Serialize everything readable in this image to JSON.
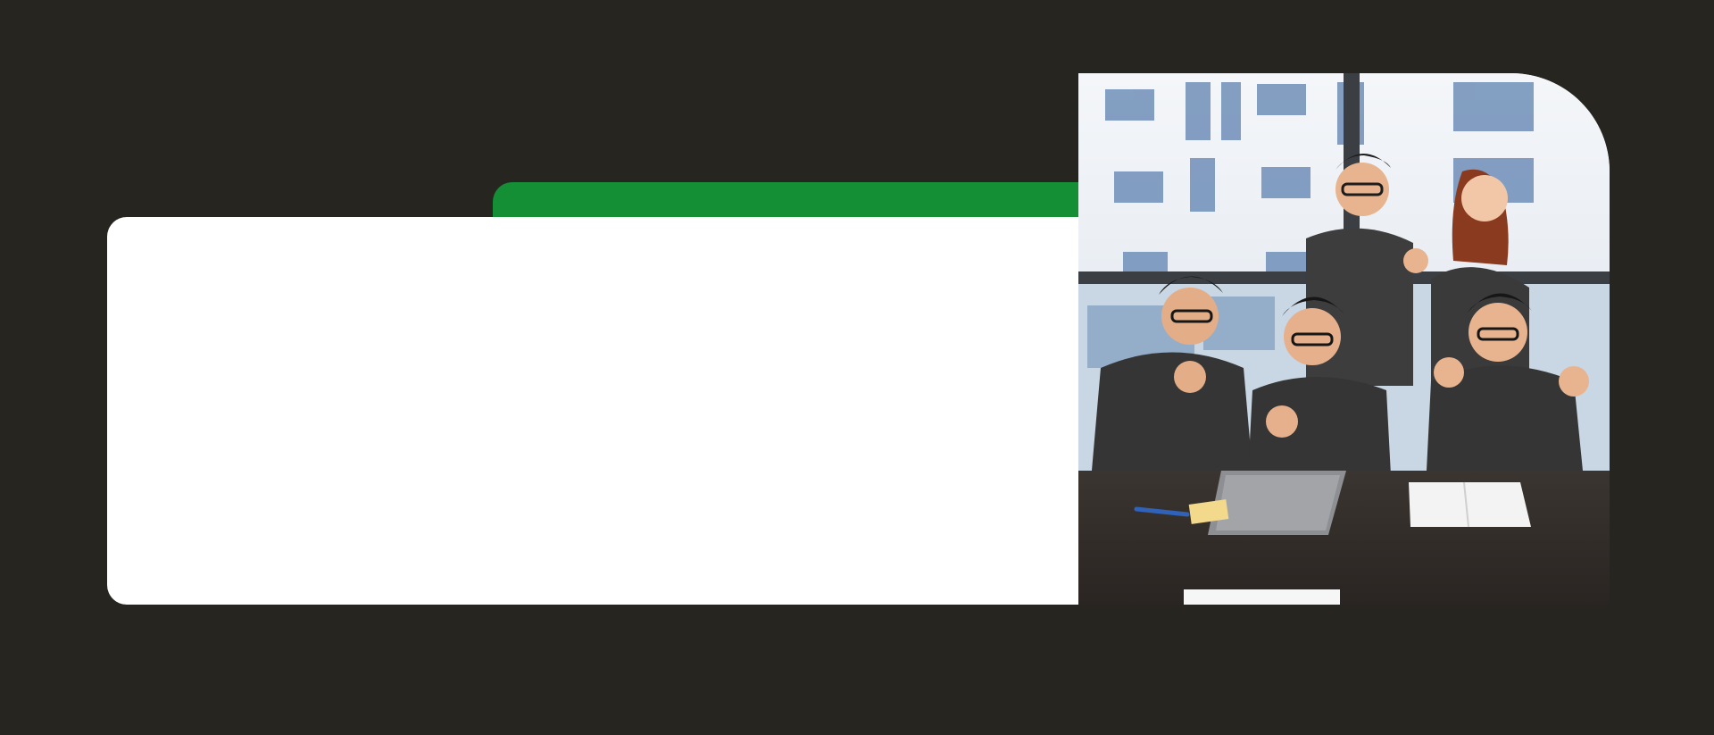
{
  "colors": {
    "background": "#26251f",
    "accent_green": "#148f35",
    "card": "#ffffff"
  },
  "photo": {
    "alt": "team-celebrating-at-laptop",
    "icon": "team-photo"
  }
}
